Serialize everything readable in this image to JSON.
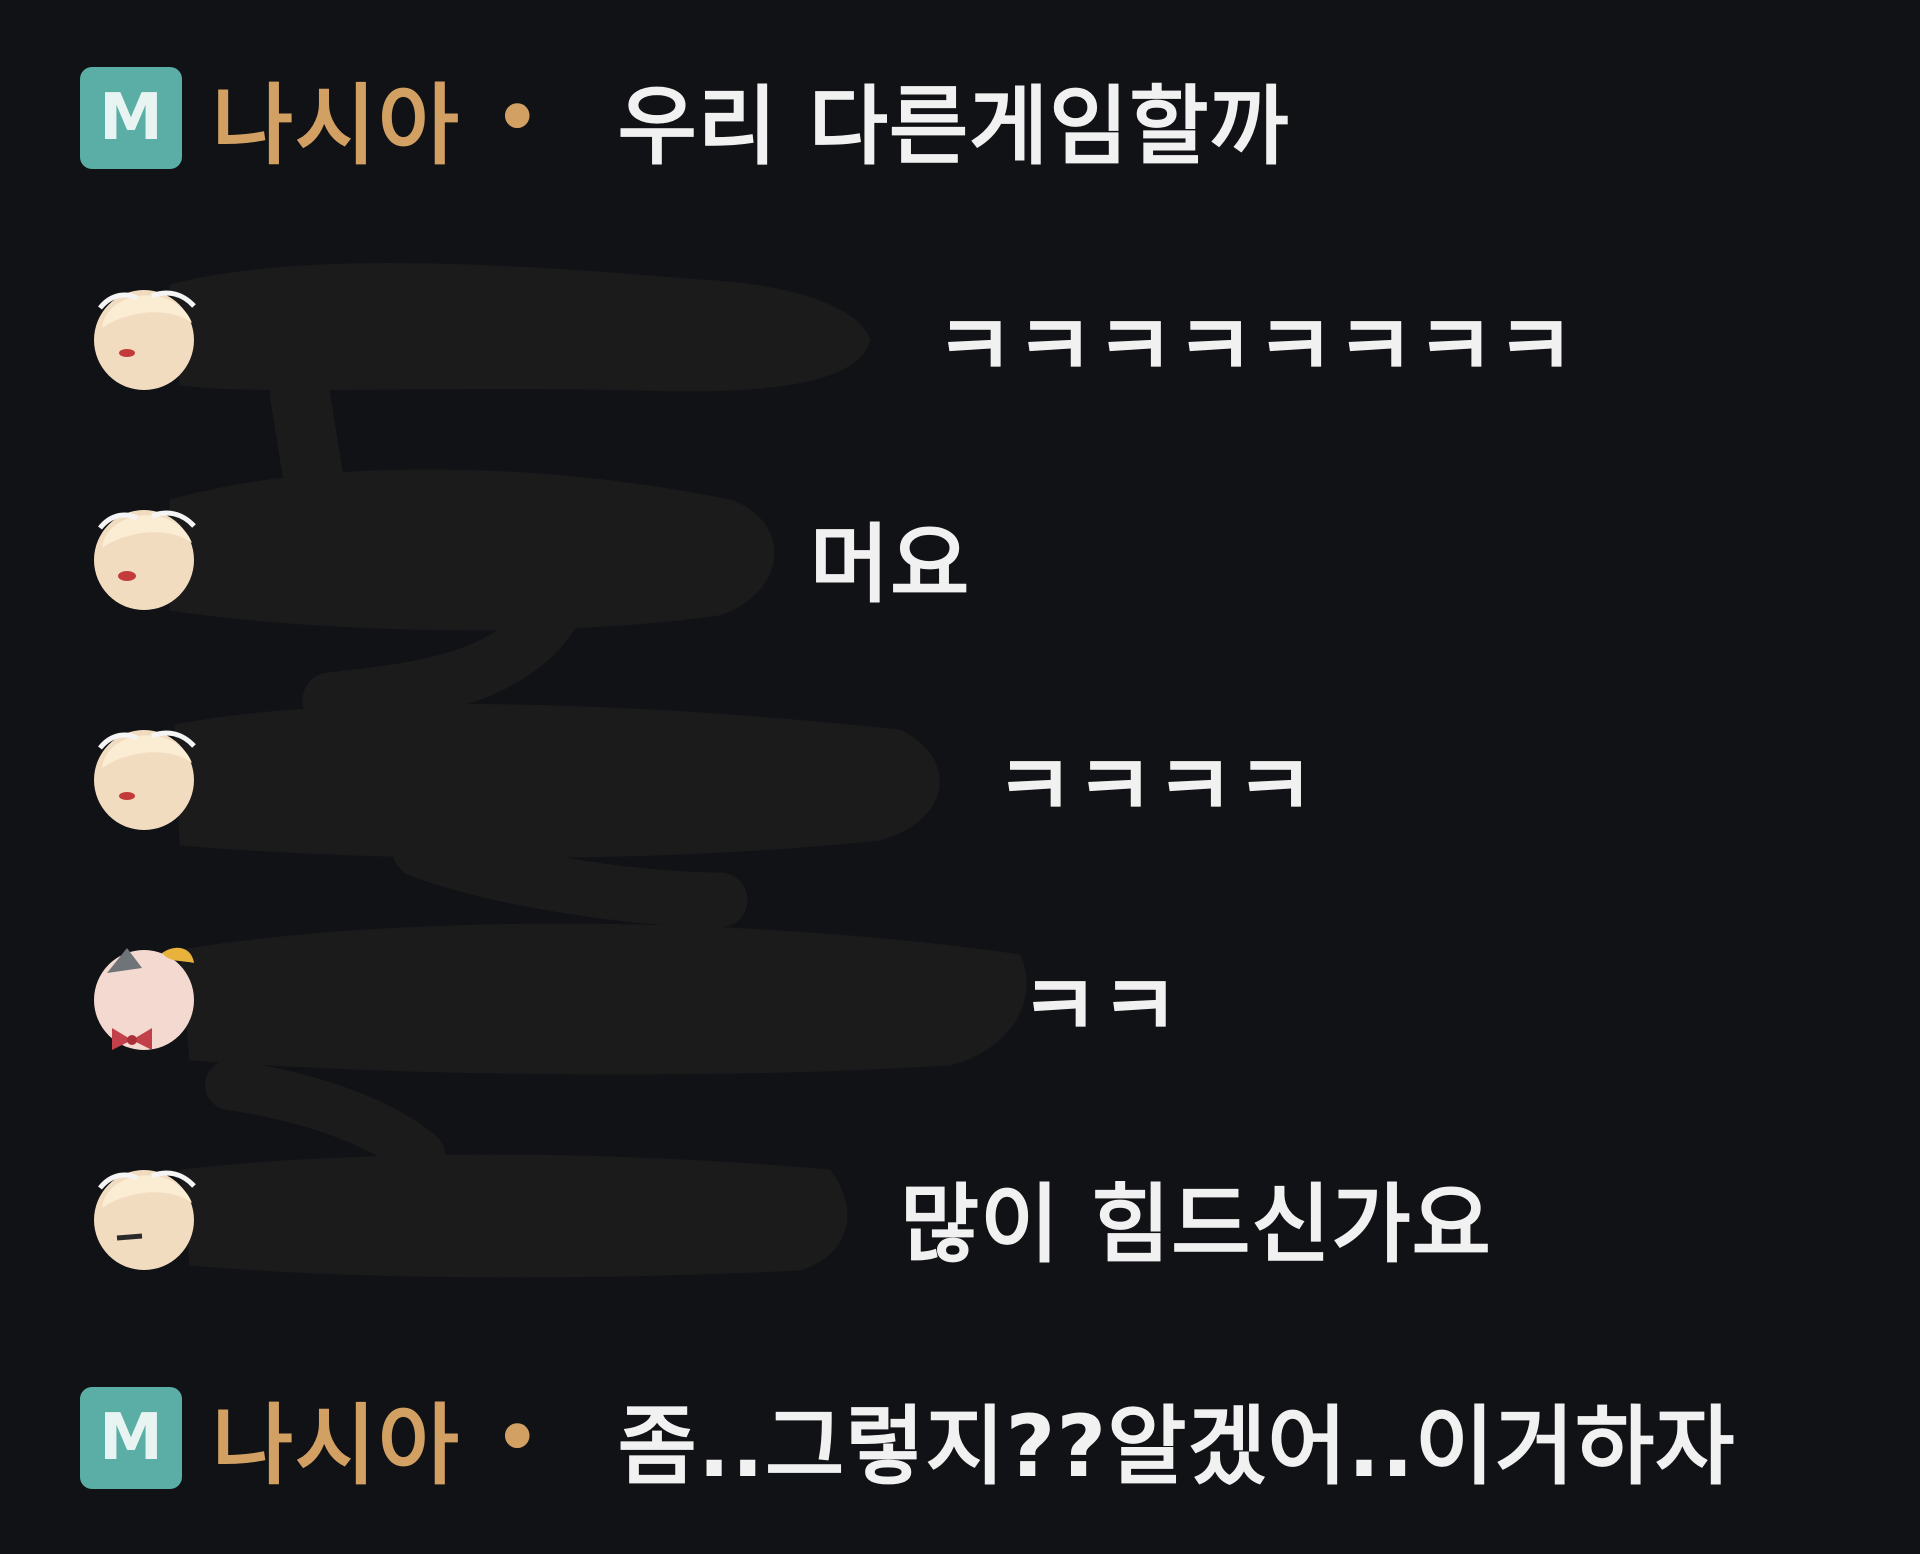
{
  "colors": {
    "background": "#111215",
    "badge": "#5aaea5",
    "nickname": "#d3a063",
    "message": "#f1f1f1",
    "redaction": "#1b1b1c"
  },
  "messages": [
    {
      "kind": "manager",
      "badge": "M",
      "nickname": "나시아",
      "separator": "•",
      "text": "우리 다른게임할까"
    },
    {
      "kind": "viewer",
      "avatar_icon": "cream-hair-avatar-icon",
      "nickname_redacted": true,
      "text": "ㅋㅋㅋㅋㅋㅋㅋㅋ"
    },
    {
      "kind": "viewer",
      "avatar_icon": "cream-hair-avatar-icon",
      "nickname_redacted": true,
      "text": "머요"
    },
    {
      "kind": "viewer",
      "avatar_icon": "cream-hair-avatar-icon",
      "nickname_redacted": true,
      "text": "ㅋㅋㅋㅋ"
    },
    {
      "kind": "viewer",
      "avatar_icon": "bow-avatar-icon",
      "nickname_redacted": true,
      "text": "ㅋㅋ"
    },
    {
      "kind": "viewer",
      "avatar_icon": "cream-hair-avatar-icon",
      "nickname_redacted": true,
      "text": "많이 힘드신가요"
    },
    {
      "kind": "manager",
      "badge": "M",
      "nickname": "나시아",
      "separator": "•",
      "text": "좀..그렇지??알겠어..이거하자"
    }
  ]
}
